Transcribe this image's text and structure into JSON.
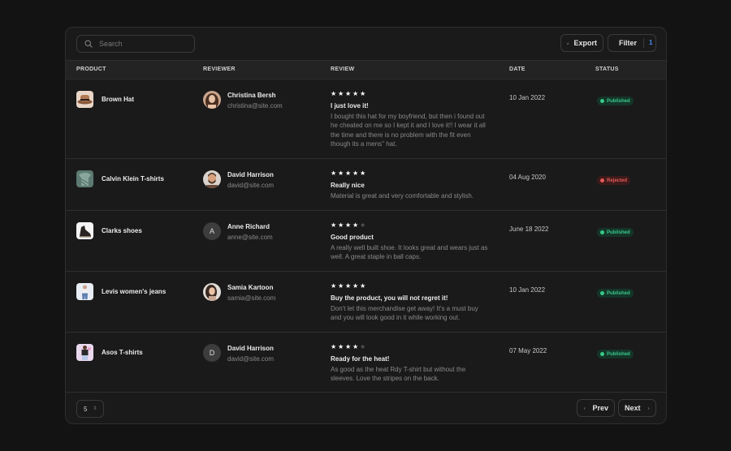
{
  "search": {
    "placeholder": "Search"
  },
  "toolbar": {
    "export_label": "Export",
    "filter_label": "Filter",
    "filter_count": "1"
  },
  "columns": {
    "product": "PRODUCT",
    "reviewer": "REVIEWER",
    "review": "REVIEW",
    "date": "DATE",
    "status": "STATUS"
  },
  "rows": [
    {
      "product": "Brown Hat",
      "reviewer": {
        "name": "Christina Bersh",
        "email": "christina@site.com",
        "initial": ""
      },
      "rating": 5,
      "review_title": "I just love it!",
      "review_body": "I bought this hat for my boyfriend, but then i found out he cheated on me so I kept it and I love it!! I wear it all the time and there is no problem with the fit even though its a mens\" hat.",
      "date": "10 Jan 2022",
      "status": "Published"
    },
    {
      "product": "Calvin Klein T-shirts",
      "reviewer": {
        "name": "David Harrison",
        "email": "david@site.com",
        "initial": ""
      },
      "rating": 5,
      "review_title": "Really nice",
      "review_body": "Material is great and very comfortable and stylish.",
      "date": "04 Aug 2020",
      "status": "Rejected"
    },
    {
      "product": "Clarks shoes",
      "reviewer": {
        "name": "Anne Richard",
        "email": "anne@site.com",
        "initial": "A"
      },
      "rating": 4,
      "review_title": "Good product",
      "review_body": "A really well built shoe. It looks great and wears just as well. A great staple in ball caps.",
      "date": "June 18 2022",
      "status": "Published"
    },
    {
      "product": "Levis women's jeans",
      "reviewer": {
        "name": "Samia Kartoon",
        "email": "samia@site.com",
        "initial": ""
      },
      "rating": 5,
      "review_title": "Buy the product, you will not regret it!",
      "review_body": "Don't let this merchandise get away! It's a must buy and you will look good in it while working out.",
      "date": "10 Jan 2022",
      "status": "Published"
    },
    {
      "product": "Asos T-shirts",
      "reviewer": {
        "name": "David Harrison",
        "email": "david@site.com",
        "initial": "D"
      },
      "rating": 4,
      "review_title": "Ready for the heat!",
      "review_body": "As good as the heat Rdy T-shirt but without the sleeves. Love the stripes on the back.",
      "date": "07 May 2022",
      "status": "Published"
    }
  ],
  "pagination": {
    "page_size": "5",
    "prev_label": "Prev",
    "next_label": "Next"
  },
  "colors": {
    "published": "#39c98a",
    "rejected": "#e35a5a",
    "accent": "#4b8cf5"
  }
}
